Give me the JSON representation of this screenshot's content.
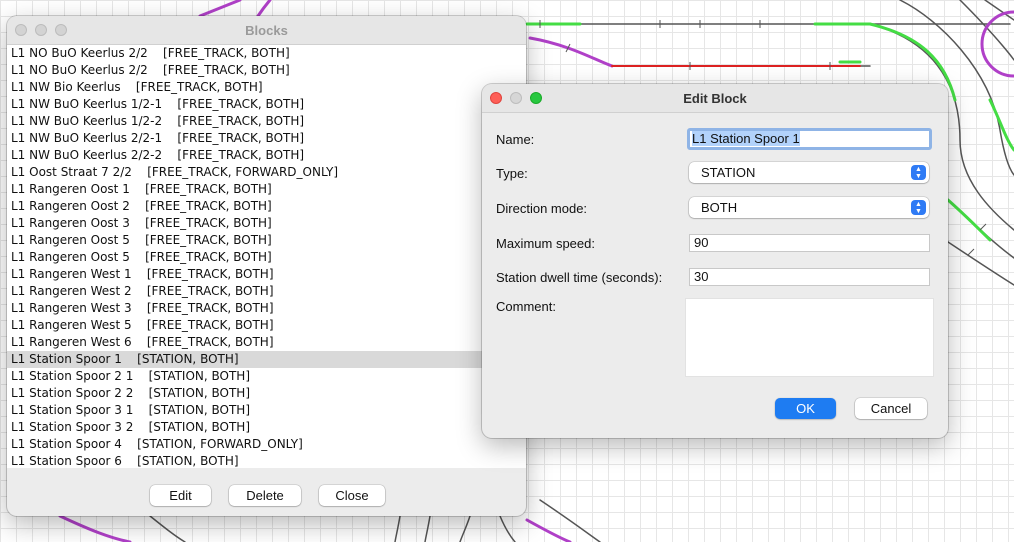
{
  "blocks_window": {
    "title": "Blocks",
    "items": [
      {
        "text": "L1 NO BuO Keerlus 2/2    [FREE_TRACK, BOTH]",
        "selected": false
      },
      {
        "text": "L1 NO BuO Keerlus 2/2    [FREE_TRACK, BOTH]",
        "selected": false
      },
      {
        "text": "L1 NW Bio Keerlus    [FREE_TRACK, BOTH]",
        "selected": false
      },
      {
        "text": "L1 NW BuO Keerlus 1/2-1    [FREE_TRACK, BOTH]",
        "selected": false
      },
      {
        "text": "L1 NW BuO Keerlus 1/2-2    [FREE_TRACK, BOTH]",
        "selected": false
      },
      {
        "text": "L1 NW BuO Keerlus 2/2-1    [FREE_TRACK, BOTH]",
        "selected": false
      },
      {
        "text": "L1 NW BuO Keerlus 2/2-2    [FREE_TRACK, BOTH]",
        "selected": false
      },
      {
        "text": "L1 Oost Straat 7 2/2    [FREE_TRACK, FORWARD_ONLY]",
        "selected": false
      },
      {
        "text": "L1 Rangeren Oost 1    [FREE_TRACK, BOTH]",
        "selected": false
      },
      {
        "text": "L1 Rangeren Oost 2    [FREE_TRACK, BOTH]",
        "selected": false
      },
      {
        "text": "L1 Rangeren Oost 3    [FREE_TRACK, BOTH]",
        "selected": false
      },
      {
        "text": "L1 Rangeren Oost 5    [FREE_TRACK, BOTH]",
        "selected": false
      },
      {
        "text": "L1 Rangeren Oost 5    [FREE_TRACK, BOTH]",
        "selected": false
      },
      {
        "text": "L1 Rangeren West 1    [FREE_TRACK, BOTH]",
        "selected": false
      },
      {
        "text": "L1 Rangeren West 2    [FREE_TRACK, BOTH]",
        "selected": false
      },
      {
        "text": "L1 Rangeren West 3    [FREE_TRACK, BOTH]",
        "selected": false
      },
      {
        "text": "L1 Rangeren West 5    [FREE_TRACK, BOTH]",
        "selected": false
      },
      {
        "text": "L1 Rangeren West 6    [FREE_TRACK, BOTH]",
        "selected": false
      },
      {
        "text": "L1 Station Spoor 1    [STATION, BOTH]",
        "selected": true
      },
      {
        "text": "L1 Station Spoor 2 1    [STATION, BOTH]",
        "selected": false
      },
      {
        "text": "L1 Station Spoor 2 2    [STATION, BOTH]",
        "selected": false
      },
      {
        "text": "L1 Station Spoor 3 1    [STATION, BOTH]",
        "selected": false
      },
      {
        "text": "L1 Station Spoor 3 2    [STATION, BOTH]",
        "selected": false
      },
      {
        "text": "L1 Station Spoor 4    [STATION, FORWARD_ONLY]",
        "selected": false
      },
      {
        "text": "L1 Station Spoor 6    [STATION, BOTH]",
        "selected": false
      }
    ],
    "buttons": {
      "edit": "Edit",
      "delete": "Delete",
      "close": "Close"
    }
  },
  "edit_dialog": {
    "title": "Edit Block",
    "labels": {
      "name": "Name:",
      "type": "Type:",
      "direction": "Direction mode:",
      "max_speed": "Maximum speed:",
      "dwell": "Station dwell time (seconds):",
      "comment": "Comment:"
    },
    "values": {
      "name": "L1 Station Spoor 1",
      "type": "STATION",
      "direction": "BOTH",
      "max_speed": "90",
      "dwell": "30",
      "comment": ""
    },
    "buttons": {
      "ok": "OK",
      "cancel": "Cancel"
    }
  },
  "colors": {
    "accent": "#1e7cf2",
    "track_dark": "#555555",
    "track_magenta": "#b040c8",
    "track_green": "#44dd44",
    "track_red": "#dd2222"
  }
}
